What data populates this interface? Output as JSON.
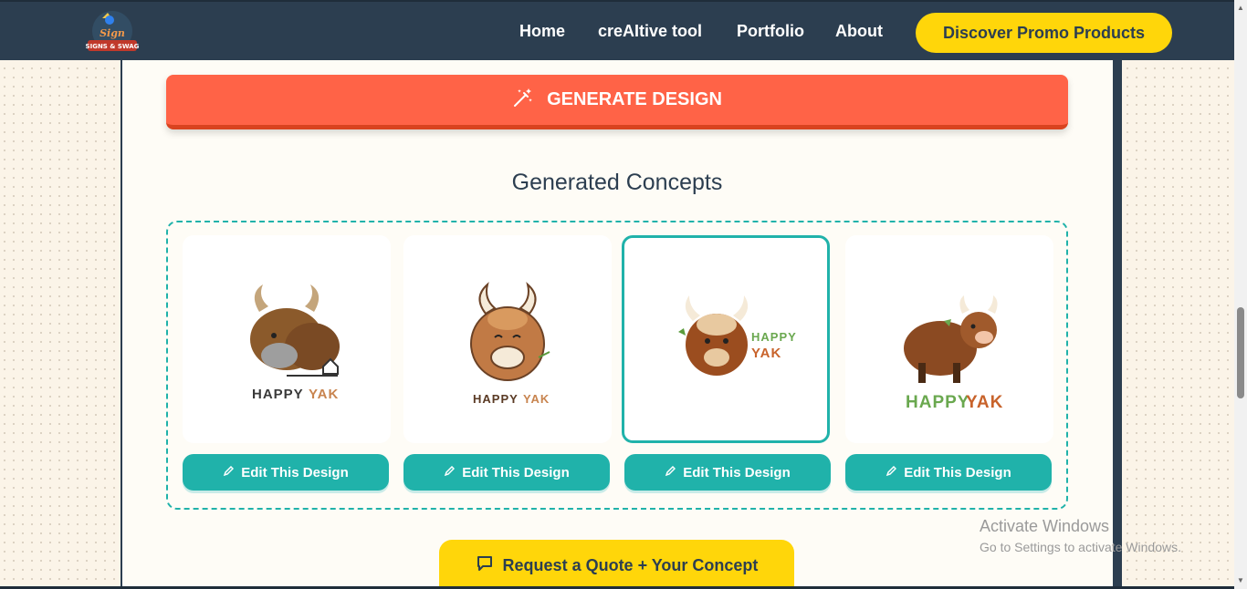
{
  "header": {
    "logo_alt": "Signs & Swag",
    "nav": [
      "Home",
      "creAItive tool",
      "Portfolio",
      "About"
    ],
    "promo_label": "Discover Promo Products"
  },
  "colors": {
    "header_bg": "#2c3e50",
    "accent_teal": "#20b2aa",
    "generate_red": "#ff6347",
    "cta_yellow": "#ffd60a"
  },
  "generate": {
    "label": "GENERATE DESIGN",
    "icon": "magic-wand-icon"
  },
  "concepts": {
    "title": "Generated Concepts",
    "items": [
      {
        "line1": "HAPPY",
        "line2": "YAK",
        "selected": false,
        "edit_label": "Edit This Design"
      },
      {
        "line1": "HAPPY",
        "line2": "YAK",
        "selected": false,
        "edit_label": "Edit This Design"
      },
      {
        "line1": "HAPPY",
        "line2": "YAK",
        "selected": true,
        "edit_label": "Edit This Design"
      },
      {
        "line1": "HAPPY",
        "line2": "YAK",
        "selected": false,
        "edit_label": "Edit This Design"
      }
    ]
  },
  "quote": {
    "label": "Request a Quote + Your Concept",
    "icon": "chat-bubble-icon"
  },
  "watermark": {
    "title": "Activate Windows",
    "subtitle": "Go to Settings to activate Windows."
  }
}
